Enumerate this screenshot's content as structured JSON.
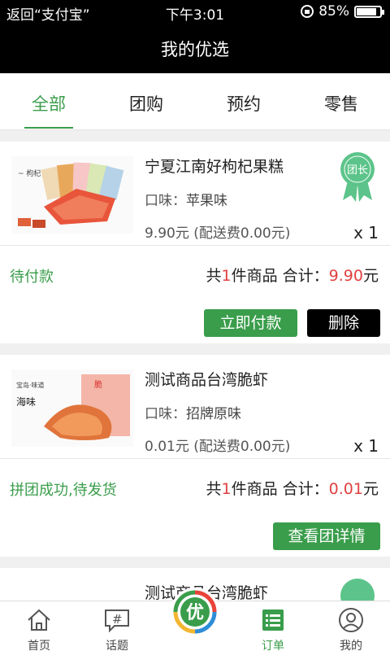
{
  "status_bar": {
    "back": "返回“支付宝”",
    "time": "下午3:01",
    "battery": "85%"
  },
  "header": {
    "title": "我的优选"
  },
  "tabs": [
    {
      "label": "全部",
      "active": true
    },
    {
      "label": "团购",
      "active": false
    },
    {
      "label": "预约",
      "active": false
    },
    {
      "label": "零售",
      "active": false
    }
  ],
  "orders": [
    {
      "name": "宁夏江南好枸杞果糕",
      "flavor_key": "口味：",
      "flavor_value": "苹果味",
      "price": "9.90元 (配送费0.00元)",
      "qty": "x 1",
      "badge": "团长",
      "status": "待付款",
      "total_prefix": "共",
      "total_count": "1",
      "total_mid": "件商品  合计：",
      "total_amount": "9.90",
      "total_unit": "元",
      "buttons": [
        "立即付款",
        "删除"
      ]
    },
    {
      "name": "测试商品台湾脆虾",
      "flavor_key": "口味：",
      "flavor_value": "招牌原味",
      "price": "0.01元 (配送费0.00元)",
      "qty": "x 1",
      "status": "拼团成功,待发货",
      "total_prefix": "共",
      "total_count": "1",
      "total_mid": "件商品  合计：",
      "total_amount": "0.01",
      "total_unit": "元",
      "buttons": [
        "查看团详情"
      ]
    },
    {
      "name": "测试商品台湾脆虾"
    }
  ],
  "bottom_nav": [
    {
      "label": "首页",
      "icon": "home-icon"
    },
    {
      "label": "话题",
      "icon": "chat-icon"
    },
    {
      "label": "",
      "icon": "logo-icon"
    },
    {
      "label": "订单",
      "icon": "list-icon",
      "active": true
    },
    {
      "label": "我的",
      "icon": "user-icon"
    }
  ],
  "colors": {
    "accent": "#3a9d4b",
    "price_red": "#e04040",
    "bar": "#000000"
  }
}
